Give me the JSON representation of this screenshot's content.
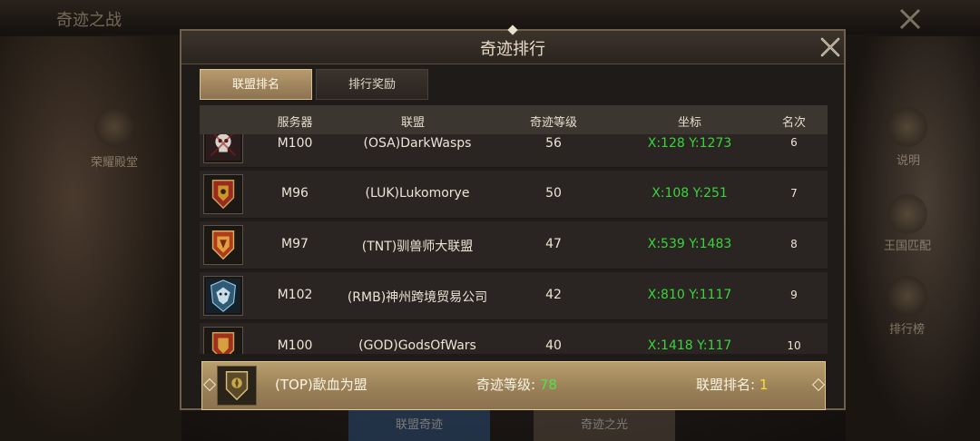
{
  "background": {
    "title": "奇迹之战",
    "left_labels": [
      "荣耀殿堂"
    ],
    "right_labels": [
      "说明",
      "王国匹配",
      "排行榜"
    ],
    "bottom_buttons": [
      "联盟奇迹",
      "奇迹之光"
    ]
  },
  "panel": {
    "title": "奇迹排行",
    "tabs": [
      {
        "label": "联盟排名",
        "active": true
      },
      {
        "label": "排行奖励",
        "active": false
      }
    ],
    "columns": [
      "服务器",
      "联盟",
      "奇迹等级",
      "坐标",
      "名次"
    ],
    "rows": [
      {
        "server": "M100",
        "alliance": "(OSA)DarkWasps",
        "level": "56",
        "coord": "X:128 Y:1273",
        "rank": "6",
        "emblem": "skull-emblem"
      },
      {
        "server": "M96",
        "alliance": "(LUK)Lukomorye",
        "level": "50",
        "coord": "X:108 Y:251",
        "rank": "7",
        "emblem": "red-shield-emblem"
      },
      {
        "server": "M97",
        "alliance": "(TNT)驯兽师大联盟",
        "level": "47",
        "coord": "X:539 Y:1483",
        "rank": "8",
        "emblem": "orange-shield-emblem"
      },
      {
        "server": "M102",
        "alliance": "(RMB)神州跨境贸易公司",
        "level": "42",
        "coord": "X:810 Y:1117",
        "rank": "9",
        "emblem": "blue-wolf-emblem"
      },
      {
        "server": "M100",
        "alliance": "(GOD)GodsOfWars",
        "level": "40",
        "coord": "X:1418 Y:117",
        "rank": "10",
        "emblem": "red-shield-emblem"
      }
    ],
    "footer": {
      "alliance": "(TOP)歃血为盟",
      "level_label": "奇迹等级:",
      "level_value": "78",
      "rank_label": "联盟排名:",
      "rank_value": "1",
      "emblem": "gold-shield-emblem"
    }
  },
  "colors": {
    "coord_green": "#39d53a",
    "footer_gold": "#b99e6e",
    "rank_yellow": "#ffd93a"
  }
}
